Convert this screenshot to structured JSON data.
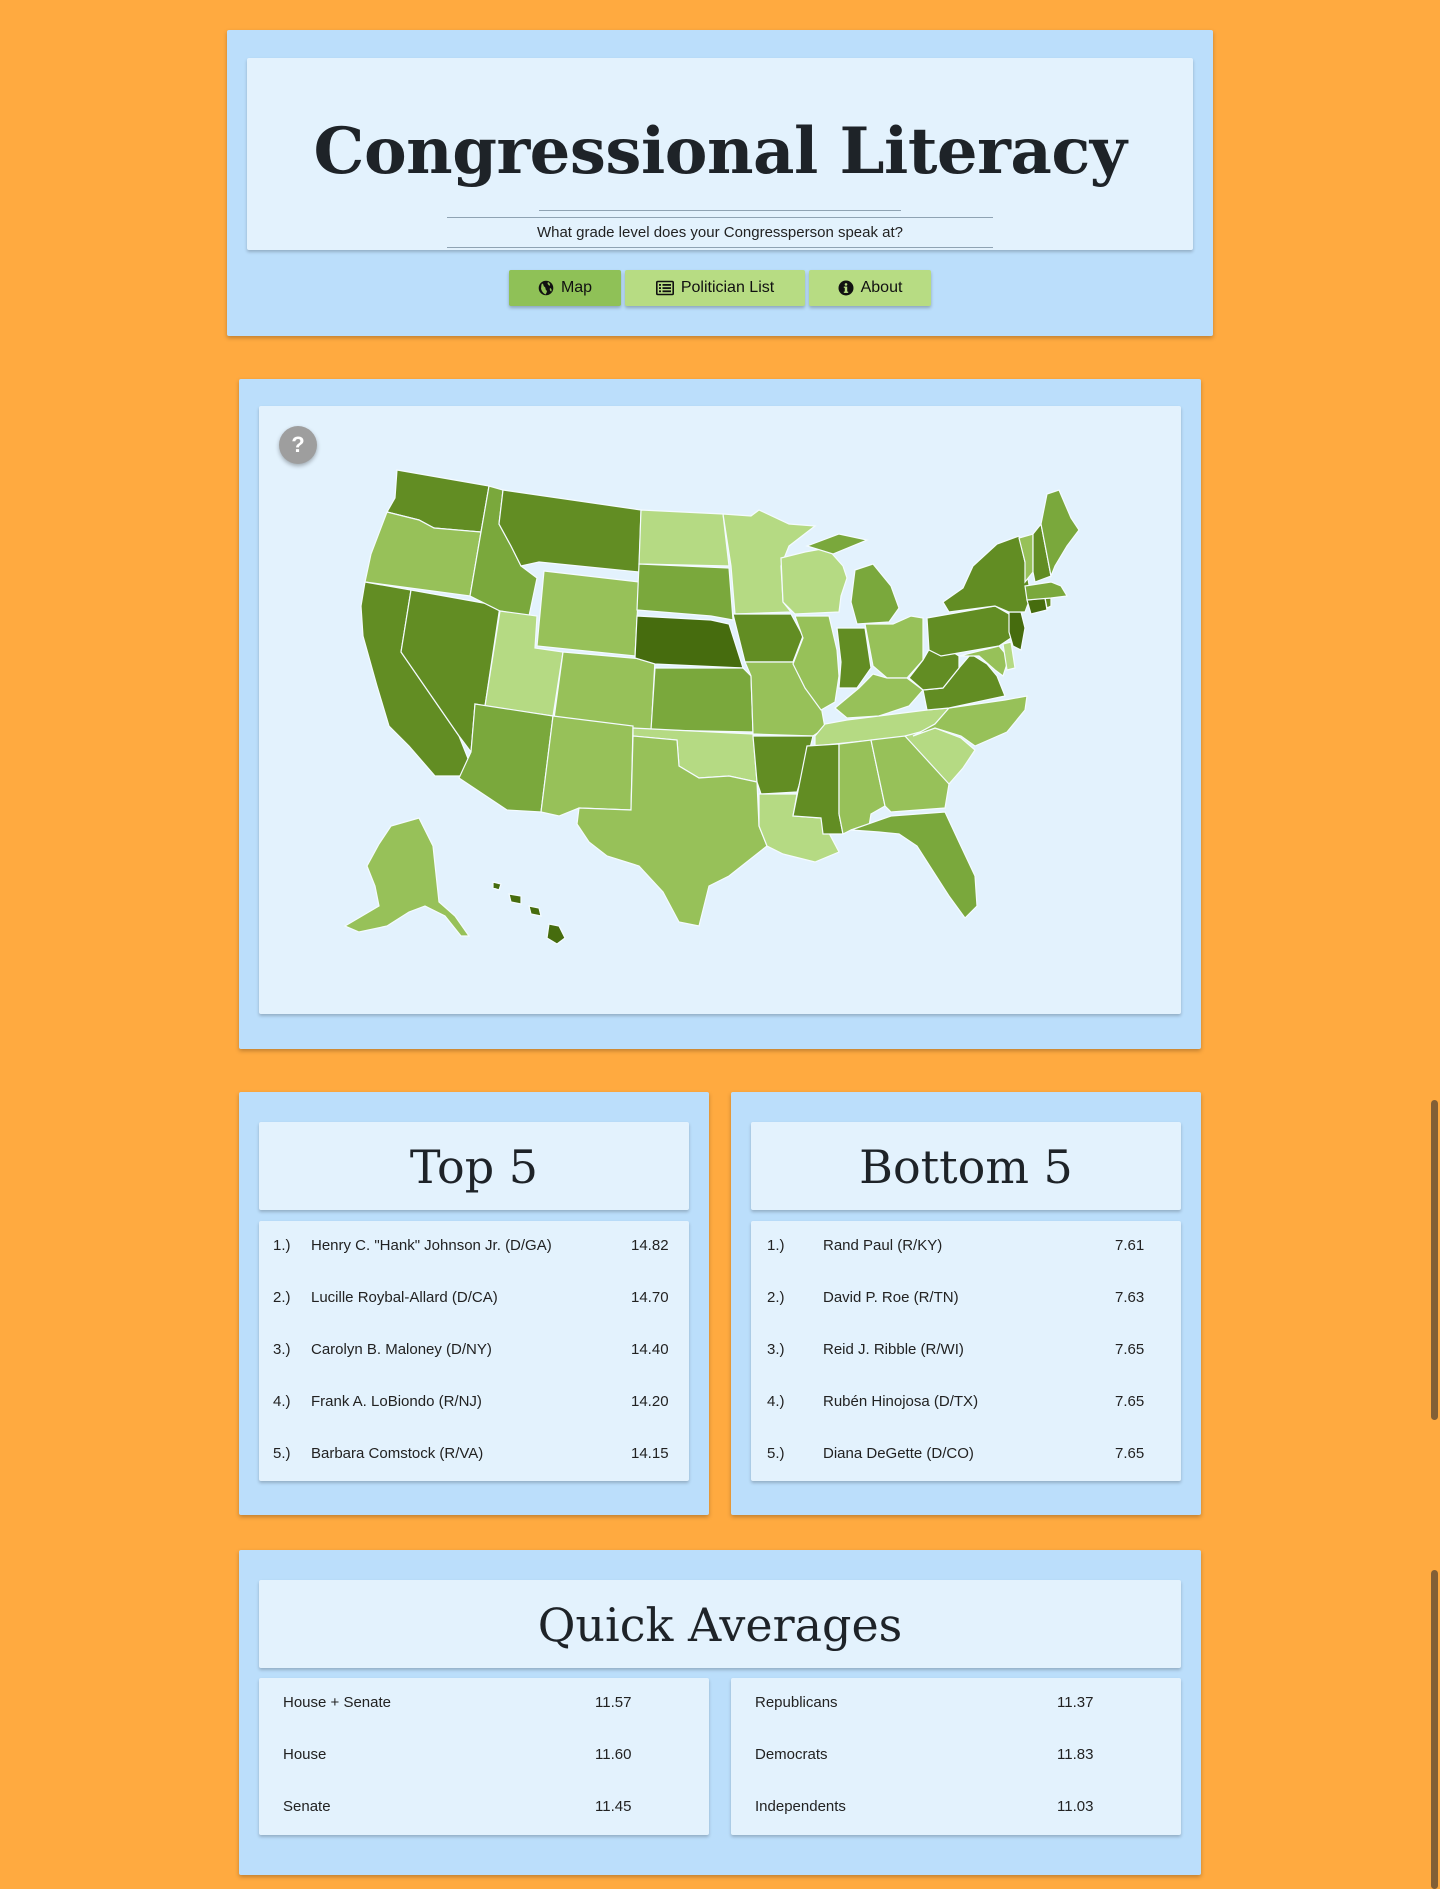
{
  "header": {
    "title": "Congressional Literacy",
    "subtitle": "What grade level does your Congressperson speak at?"
  },
  "nav": {
    "items": [
      {
        "label": "Map",
        "icon": "globe-icon"
      },
      {
        "label": "Politician List",
        "icon": "list-icon"
      },
      {
        "label": "About",
        "icon": "info-icon"
      }
    ],
    "active": "Map"
  },
  "map": {
    "help_label": "?",
    "colors": {
      "lightest": "#b5da83",
      "light": "#97c159",
      "medium": "#7aa83c",
      "dark": "#628d23",
      "darkest": "#466c0e"
    }
  },
  "top5": {
    "title": "Top 5",
    "rows": [
      {
        "rank": "1.)",
        "name": "Henry C. \"Hank\" Johnson Jr. (D/GA)",
        "score": "14.82"
      },
      {
        "rank": "2.)",
        "name": "Lucille Roybal-Allard (D/CA)",
        "score": "14.70"
      },
      {
        "rank": "3.)",
        "name": "Carolyn B. Maloney (D/NY)",
        "score": "14.40"
      },
      {
        "rank": "4.)",
        "name": "Frank A. LoBiondo (R/NJ)",
        "score": "14.20"
      },
      {
        "rank": "5.)",
        "name": "Barbara Comstock (R/VA)",
        "score": "14.15"
      }
    ]
  },
  "bottom5": {
    "title": "Bottom 5",
    "rows": [
      {
        "rank": "1.)",
        "name": "Rand Paul (R/KY)",
        "score": "7.61"
      },
      {
        "rank": "2.)",
        "name": "David P. Roe (R/TN)",
        "score": "7.63"
      },
      {
        "rank": "3.)",
        "name": "Reid J. Ribble (R/WI)",
        "score": "7.65"
      },
      {
        "rank": "4.)",
        "name": "Rubén Hinojosa (D/TX)",
        "score": "7.65"
      },
      {
        "rank": "5.)",
        "name": "Diana DeGette (D/CO)",
        "score": "7.65"
      }
    ]
  },
  "averages": {
    "title": "Quick Averages",
    "left": [
      {
        "label": "House + Senate",
        "value": "11.57"
      },
      {
        "label": "House",
        "value": "11.60"
      },
      {
        "label": "Senate",
        "value": "11.45"
      }
    ],
    "right": [
      {
        "label": "Republicans",
        "value": "11.37"
      },
      {
        "label": "Democrats",
        "value": "11.83"
      },
      {
        "label": "Independents",
        "value": "11.03"
      }
    ]
  }
}
